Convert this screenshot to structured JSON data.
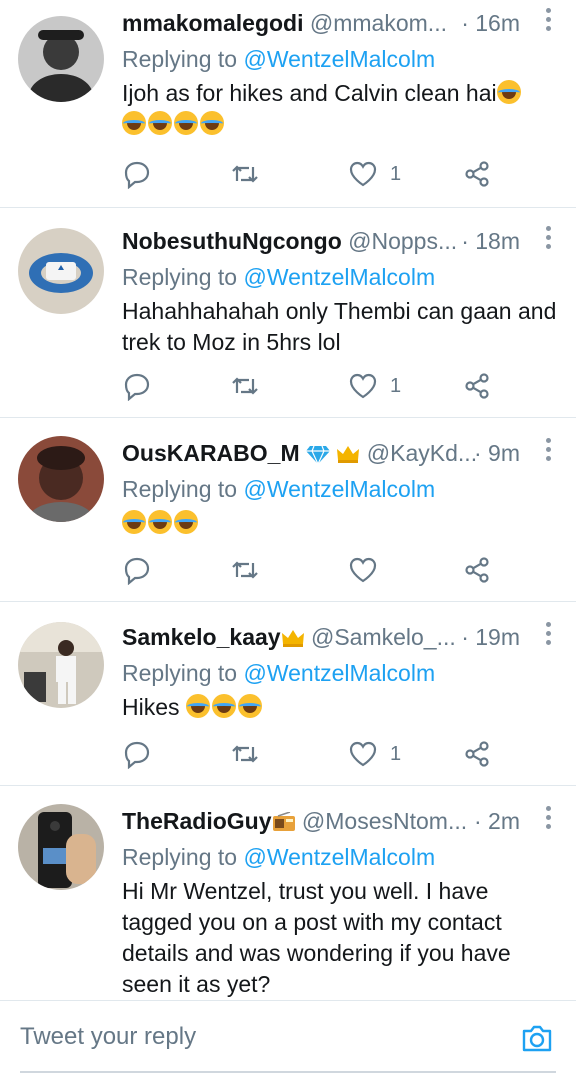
{
  "tweets": [
    {
      "name": "mmakomalegodi",
      "handle": "@mmakom...",
      "time": "· 16m",
      "replying_prefix": "Replying to ",
      "replying_to": "@WentzelMalcolm",
      "text": "Ijoh as for hikes and Calvin clean hai",
      "likes": "1"
    },
    {
      "name": "NobesuthuNgcongo",
      "handle": "@Nopps...",
      "time": "· 18m",
      "replying_prefix": "Replying to ",
      "replying_to": "@WentzelMalcolm",
      "text": "Hahahhahahah only Thembi can gaan and trek to Moz in 5hrs lol",
      "likes": "1"
    },
    {
      "name": "OusKARABO_M",
      "handle": "@KayKd...",
      "time": "· 9m",
      "replying_prefix": "Replying to ",
      "replying_to": "@WentzelMalcolm",
      "text": "",
      "likes": ""
    },
    {
      "name": "Samkelo_kaay",
      "handle": "@Samkelo_...",
      "time": "· 19m",
      "replying_prefix": "Replying to ",
      "replying_to": "@WentzelMalcolm",
      "text": "Hikes",
      "likes": "1"
    },
    {
      "name": "TheRadioGuy",
      "handle": "@MosesNtom...",
      "time": "· 2m",
      "replying_prefix": "Replying to ",
      "replying_to": "@WentzelMalcolm",
      "text": "Hi Mr Wentzel, trust you well. I have tagged you on a post with my contact details and was wondering if you have seen it as yet?",
      "likes": ""
    }
  ],
  "footer": {
    "placeholder": "Tweet your reply"
  },
  "icons": {
    "reply": "reply-icon",
    "retweet": "retweet-icon",
    "like": "heart-icon",
    "share": "share-icon",
    "more": "more-vertical-icon",
    "camera": "camera-icon"
  },
  "colors": {
    "accent": "#1da1f2",
    "muted": "#657786",
    "divider": "#e1e8ed"
  }
}
